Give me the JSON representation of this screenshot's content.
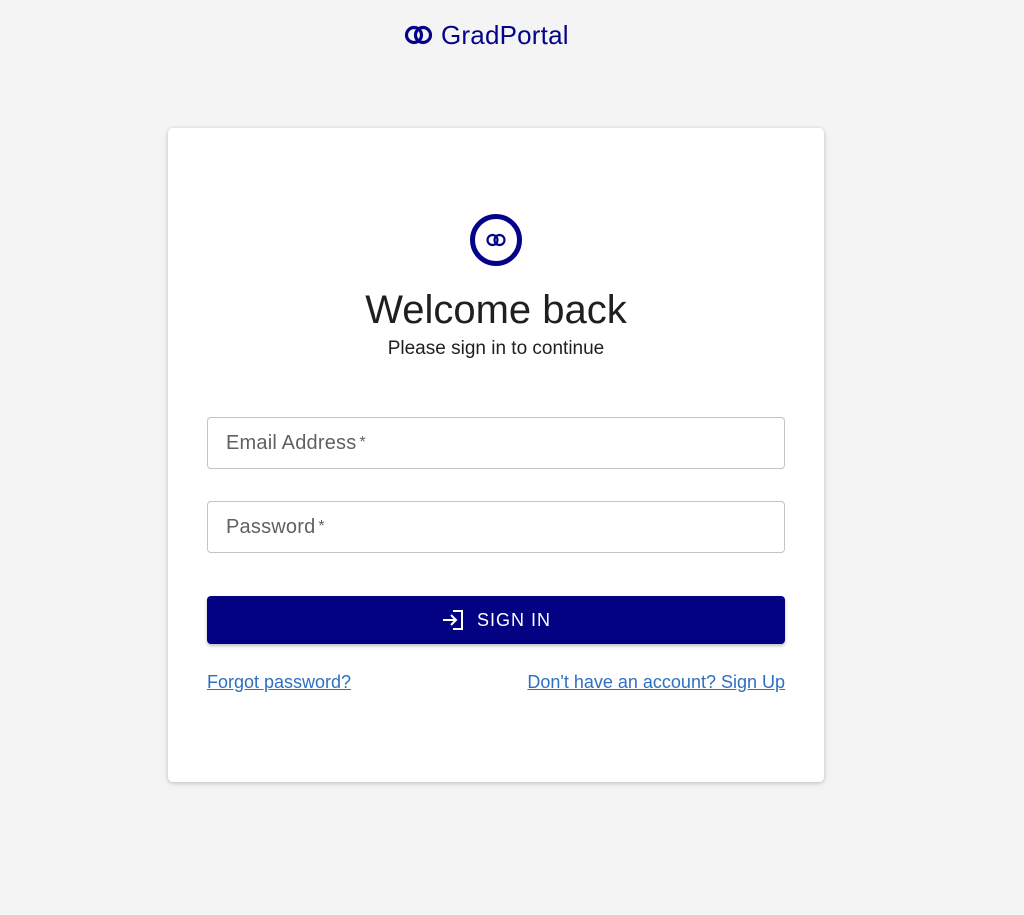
{
  "header": {
    "brand_name": "GradPortal",
    "brand_icon": "rings-logo-icon"
  },
  "login": {
    "logo_icon": "rings-logo-icon",
    "title": "Welcome back",
    "subtitle": "Please sign in to continue",
    "email": {
      "label": "Email Address",
      "required_marker": "*",
      "value": ""
    },
    "password": {
      "label": "Password",
      "required_marker": "*",
      "value": ""
    },
    "submit": {
      "label": "SIGN IN",
      "icon": "login-arrow-icon"
    },
    "forgot_link": "Forgot password?",
    "signup_link": "Don't have an account? Sign Up"
  },
  "colors": {
    "brand": "#04048a",
    "button_bg": "#020283",
    "link": "#2f6fc1",
    "page_bg": "#f4f4f4",
    "card_bg": "#ffffff"
  }
}
